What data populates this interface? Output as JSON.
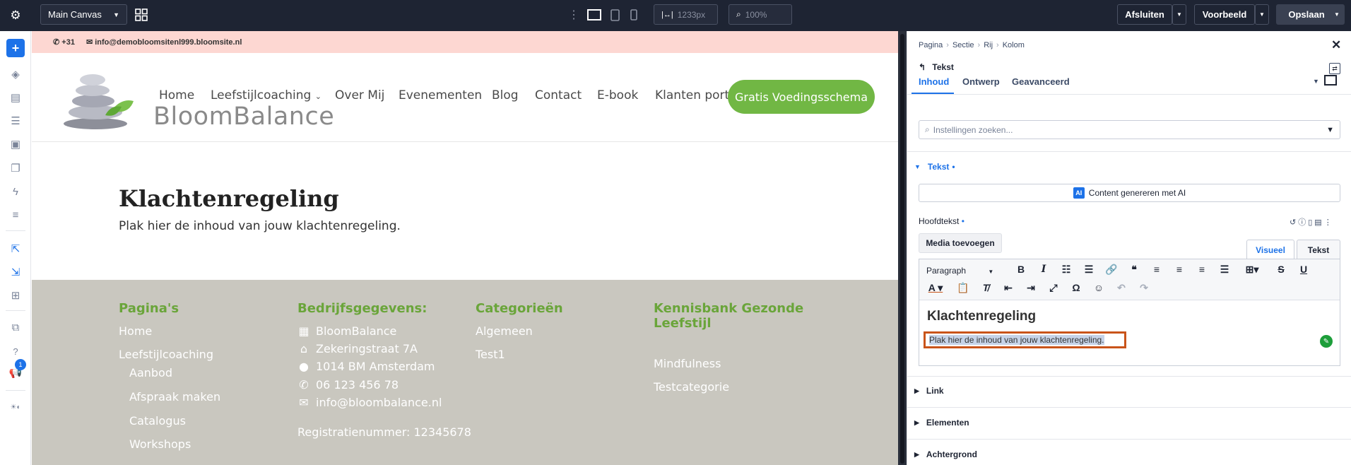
{
  "topbar": {
    "canvas_select": "Main Canvas",
    "width_value": "1233px",
    "zoom_value": "100%",
    "close_label": "Afsluiten",
    "preview_label": "Voorbeeld",
    "save_label": "Opslaan"
  },
  "sidebar": {
    "notification_count": "1"
  },
  "site": {
    "phone": "+31",
    "email_top": "info@demobloomsitenl999.bloomsite.nl",
    "logo_text": "BloomBalance",
    "nav": [
      "Home",
      "Leefstijlcoaching",
      "Over Mij",
      "Evenementen",
      "Blog",
      "Contact",
      "E-book",
      "Klanten portaal"
    ],
    "cta": "Gratis Voedingsschema",
    "page_title": "Klachtenregeling",
    "page_subtitle": "Plak hier de inhoud van jouw klachtenregeling.",
    "footer": {
      "col1_title": "Pagina's",
      "col1_items": [
        "Home",
        "Leefstijlcoaching",
        "Aanbod",
        "Afspraak maken",
        "Catalogus",
        "Workshops"
      ],
      "col2_title": "Bedrijfsgegevens:",
      "col2_items": [
        "BloomBalance",
        "Zekeringstraat 7A",
        "1014 BM Amsterdam",
        "06 123 456 78",
        "info@bloombalance.nl"
      ],
      "col2_reg": "Registratienummer: 12345678",
      "col3_title": "Categorieën",
      "col3_items": [
        "Algemeen",
        "Test1"
      ],
      "col4_title_line1": "Kennisbank Gezonde",
      "col4_title_line2": "Leefstijl",
      "col4_items": [
        "Mindfulness",
        "Testcategorie"
      ]
    }
  },
  "panel": {
    "breadcrumb": [
      "Pagina",
      "Sectie",
      "Rij",
      "Kolom"
    ],
    "element_title": "Tekst",
    "tabs": [
      "Inhoud",
      "Ontwerp",
      "Geavanceerd"
    ],
    "search_placeholder": "Instellingen zoeken...",
    "section_text": "Tekst",
    "ai_badge": "AI",
    "ai_button": "Content genereren met AI",
    "field_label": "Hoofdtekst",
    "media_button": "Media toevoegen",
    "mode_visual": "Visueel",
    "mode_text": "Tekst",
    "format_select": "Paragraph",
    "editor_heading": "Klachtenregeling",
    "editor_paragraph": "Plak hier de inhoud van jouw klachtenregeling.",
    "sections": [
      "Link",
      "Elementen",
      "Achtergrond"
    ]
  },
  "colors": {
    "accent_blue": "#1d72e8",
    "brand_green": "#71b744",
    "footer_bg": "#c9c7bf",
    "top_strip": "#fdd7d2",
    "selection_outline": "#c9541a"
  }
}
